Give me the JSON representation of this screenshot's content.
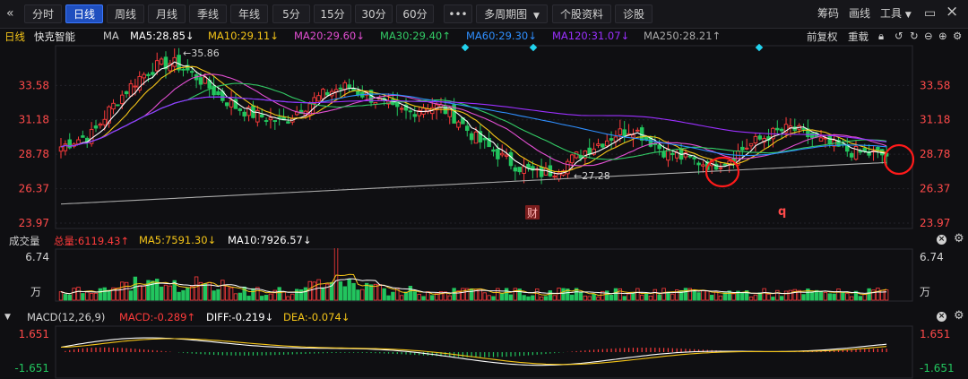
{
  "toolbar": {
    "left_items": [
      "分时",
      "日线",
      "周线",
      "月线",
      "季线",
      "年线",
      "5分",
      "15分",
      "30分",
      "60分"
    ],
    "active_item": "日线",
    "more_label": "•••",
    "multi_period_label": "多周期图",
    "stock_info_label": "个股资料",
    "diagnose_label": "诊股",
    "right_items": [
      "筹码",
      "画线",
      "工具"
    ]
  },
  "ma_bar": {
    "period_label": "日线",
    "stock_name": "快克智能",
    "ma_label": "MA",
    "ma5": "MA5:28.85↓",
    "ma10": "MA10:29.11↓",
    "ma20": "MA20:29.60↓",
    "ma30": "MA30:29.40↑",
    "ma60": "MA60:29.30↓",
    "ma120": "MA120:31.07↓",
    "ma250": "MA250:28.21↑",
    "right_label_1": "前复权",
    "right_label_2": "重载"
  },
  "main_chart": {
    "y_ticks": [
      "33.58",
      "31.18",
      "28.78",
      "26.37",
      "23.97"
    ],
    "high_label": "←35.86",
    "low_label": "←27.28",
    "finance_marker": "财",
    "q_marker": "q",
    "colors": {
      "up": "#ff3b3b",
      "down": "#22c55e",
      "ma5": "#ffffff",
      "ma10": "#f5c518",
      "ma20": "#e34fd3",
      "ma30": "#33cc66",
      "ma60": "#2f8fff",
      "ma120": "#9b30ff",
      "ma250": "#aaaaaa"
    }
  },
  "volume": {
    "title": "成交量",
    "total": "总量:6119.43↑",
    "ma5": "MA5:7591.30↓",
    "ma10": "MA10:7926.57↓",
    "y_top": "6.74",
    "y_unit": "万"
  },
  "macd": {
    "title": "MACD(12,26,9)",
    "macd": "MACD:-0.289↑",
    "diff": "DIFF:-0.219↓",
    "dea": "DEA:-0.074↓",
    "y_top": "1.651",
    "y_bottom": "-1.651"
  },
  "chart_data": {
    "type": "candlestick",
    "ylim": [
      23.97,
      35.98
    ],
    "high": 35.86,
    "low": 27.28,
    "close_path_approx": [
      29.3,
      29.8,
      30.2,
      31.8,
      33.1,
      34.2,
      34.9,
      35.2,
      34.6,
      33.8,
      32.8,
      32.1,
      31.6,
      31.3,
      31.0,
      31.9,
      32.6,
      33.2,
      33.5,
      33.0,
      32.5,
      31.8,
      31.7,
      32.2,
      32.0,
      31.2,
      30.0,
      29.2,
      28.4,
      27.8,
      27.4,
      27.6,
      28.3,
      29.0,
      29.6,
      30.2,
      30.6,
      29.8,
      29.0,
      28.6,
      28.3,
      28.0,
      28.4,
      29.2,
      29.8,
      30.3,
      30.6,
      30.1,
      29.6,
      29.2,
      28.9,
      28.8,
      28.7
    ]
  }
}
